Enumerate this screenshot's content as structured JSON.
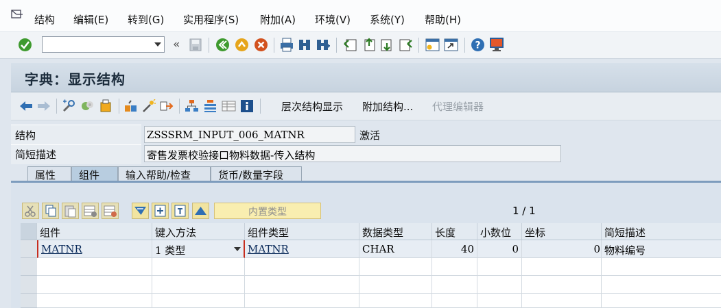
{
  "menubar": {
    "items": [
      "结构",
      "编辑(E)",
      "转到(G)",
      "实用程序(S)",
      "附加(A)",
      "环境(V)",
      "系统(Y)",
      "帮助(H)"
    ]
  },
  "toolbar": {
    "command_value": "",
    "icons": [
      "enter-icon",
      "save-icon",
      "back-icon",
      "exit-icon",
      "cancel-icon",
      "print-icon",
      "find-icon",
      "find-next-icon",
      "first-page-icon",
      "prev-page-icon",
      "next-page-icon",
      "last-page-icon",
      "new-session-icon",
      "shortcut-icon",
      "help-icon",
      "layout-icon"
    ],
    "chevron": "«"
  },
  "title": "字典：显示结构",
  "app_toolbar": {
    "hierarchy_label": "层次结构显示",
    "append_label": "附加结构...",
    "proxy_label": "代理编辑器"
  },
  "header": {
    "structure_label": "结构",
    "structure_value": "ZSSSRM_INPUT_006_MATNR",
    "status": "激活",
    "desc_label": "简短描述",
    "desc_value": "寄售发票校验接口物料数据-传入结构"
  },
  "tabs": [
    {
      "label": "属性",
      "active": false
    },
    {
      "label": "组件",
      "active": true
    },
    {
      "label": "输入帮助/检查",
      "active": false
    },
    {
      "label": "货币/数量字段",
      "active": false
    }
  ],
  "table_toolbar": {
    "builtin_type_label": "内置类型",
    "page_info": "1 / 1"
  },
  "table": {
    "columns": [
      "组件",
      "键入方法",
      "组件类型",
      "数据类型",
      "长度",
      "小数位",
      "坐标",
      "简短描述"
    ],
    "rows": [
      {
        "component": "MATNR",
        "typing_method": "1 类型",
        "component_type": "MATNR",
        "data_type": "CHAR",
        "length": "40",
        "decimals": "0",
        "coordinate": "0",
        "short_desc": "物料编号"
      }
    ]
  }
}
